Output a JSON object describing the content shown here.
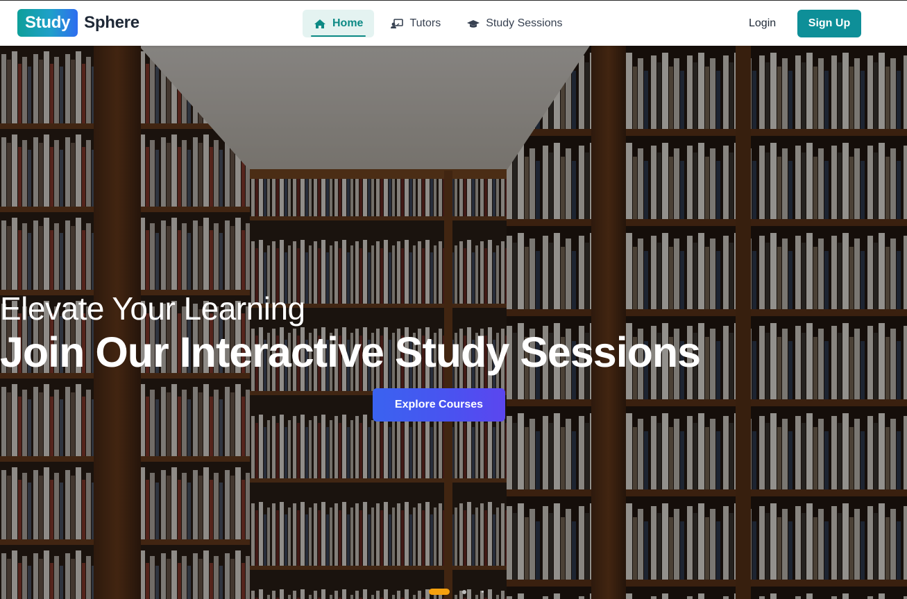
{
  "brand": {
    "part1": "Study",
    "part2": "Sphere"
  },
  "nav": {
    "items": [
      {
        "label": "Home",
        "icon": "home-icon",
        "active": true
      },
      {
        "label": "Tutors",
        "icon": "chalkboard-teacher-icon",
        "active": false
      },
      {
        "label": "Study Sessions",
        "icon": "graduation-cap-icon",
        "active": false
      }
    ]
  },
  "auth": {
    "login": "Login",
    "signup": "Sign Up"
  },
  "hero": {
    "subtitle": "Elevate Your Learning",
    "title": "Join Our Interactive Study Sessions",
    "cta": "Explore Courses",
    "background": "library-bookshelves-image"
  },
  "carousel": {
    "active_index": 0,
    "count": 3
  },
  "colors": {
    "brand_teal": "#0e8f98",
    "nav_active_bg": "#e4f3f1",
    "cta_blue": "#4a52f0",
    "dot_active": "#f6a10e"
  }
}
